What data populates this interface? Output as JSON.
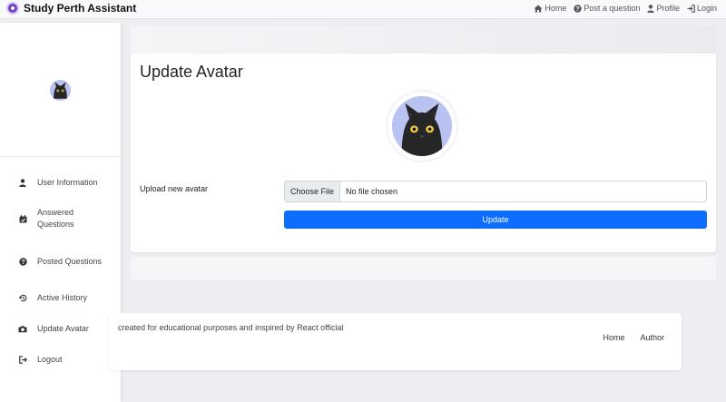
{
  "navbar": {
    "brand": "Study Perth Assistant",
    "links": [
      {
        "label": "Home",
        "icon": "home-icon"
      },
      {
        "label": "Post a question",
        "icon": "question-circle-icon"
      },
      {
        "label": "Profile",
        "icon": "user-icon"
      },
      {
        "label": "Login",
        "icon": "login-icon"
      }
    ]
  },
  "sidebar": {
    "avatar_icon": "black-cat-avatar",
    "items": [
      {
        "label": "User Information",
        "icon": "user-icon"
      },
      {
        "label": "Answered Questions",
        "icon": "calendar-check-icon"
      },
      {
        "label": "Posted Questions",
        "icon": "question-circle-icon"
      },
      {
        "label": "Active History",
        "icon": "history-icon"
      },
      {
        "label": "Update Avatar",
        "icon": "camera-icon"
      },
      {
        "label": "Logout",
        "icon": "logout-icon"
      }
    ]
  },
  "main": {
    "title": "Update Avatar",
    "upload_label": "Upload new avatar",
    "file_button": "Choose File",
    "file_status": "No file chosen",
    "submit_label": "Update",
    "colors": {
      "primary": "#0d6efd",
      "avatar_bg": "#b9c3f2"
    }
  },
  "footer": {
    "text": "created for educational purposes and inspired by React official",
    "links": [
      "Home",
      "Author"
    ]
  }
}
